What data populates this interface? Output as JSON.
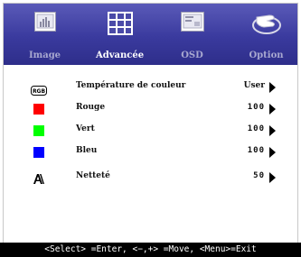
{
  "tabs": [
    {
      "label": "Image",
      "icon": "image-icon",
      "active": false
    },
    {
      "label": "Advancée",
      "icon": "grid-icon",
      "active": true
    },
    {
      "label": "OSD",
      "icon": "osd-icon",
      "active": false
    },
    {
      "label": "Option",
      "icon": "hand-icon",
      "active": false
    }
  ],
  "rows": [
    {
      "label": "Température de couleur",
      "value": "User",
      "icon": "rgb-icon",
      "color": "#000000"
    },
    {
      "label": "Rouge",
      "value": "100",
      "icon": "red-square-icon",
      "color": "#ff0000"
    },
    {
      "label": "Vert",
      "value": "100",
      "icon": "green-square-icon",
      "color": "#00ff00"
    },
    {
      "label": "Bleu",
      "value": "100",
      "icon": "blue-square-icon",
      "color": "#0000ff"
    },
    {
      "label": "Netteté",
      "value": "50",
      "icon": "sharpness-icon",
      "color": "#000000"
    }
  ],
  "icon_text": {
    "rgb": "RGB"
  },
  "footer": "<Select> =Enter, <−,+> =Move, <Menu>=Exit",
  "colors": {
    "topbar": "#3a3a9e",
    "active_label": "#ffffff",
    "inactive_label": "#a8a8d0"
  }
}
